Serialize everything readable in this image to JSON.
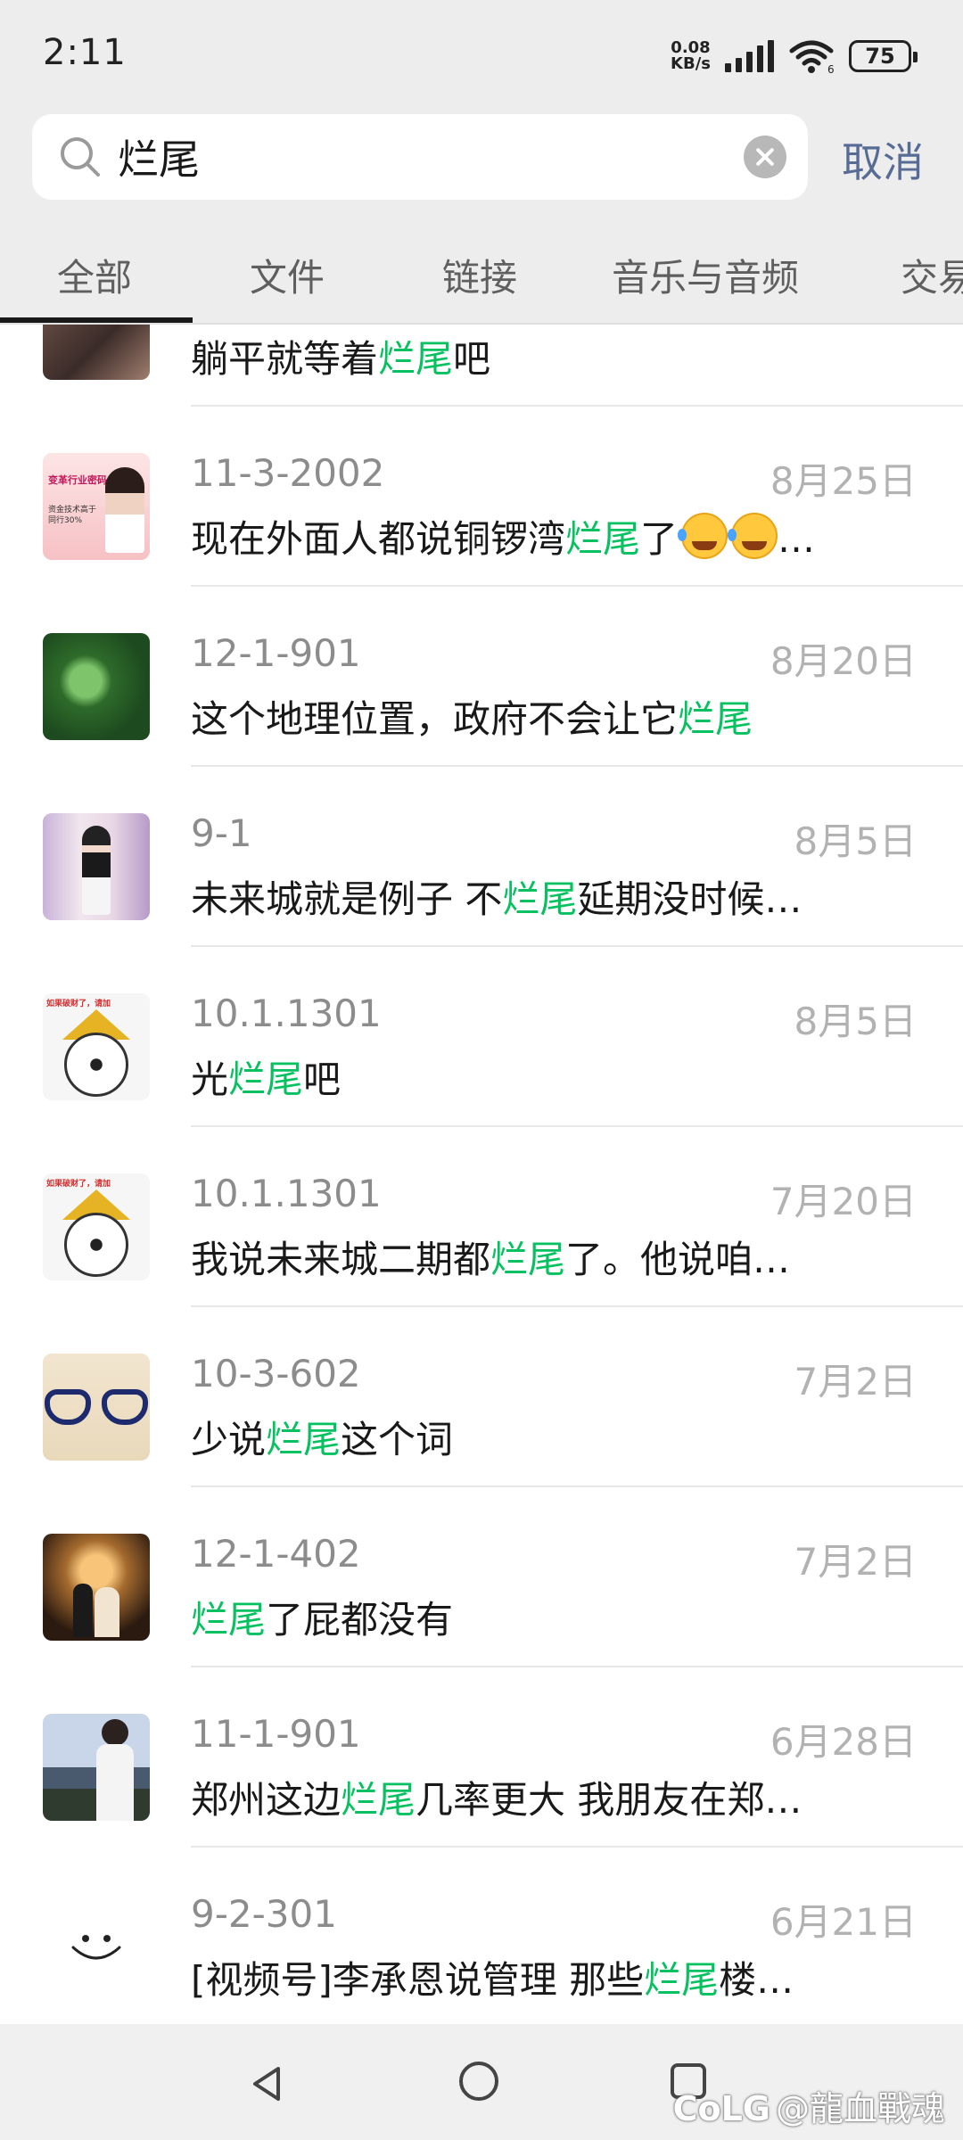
{
  "status_bar": {
    "time": "2:11",
    "net_speed_value": "0.08",
    "net_speed_unit": "KB/s",
    "battery": "75",
    "wifi_badge": "6"
  },
  "search": {
    "query": "烂尾",
    "cancel_label": "取消"
  },
  "tabs": [
    {
      "label": "全部",
      "active": true
    },
    {
      "label": "文件",
      "active": false
    },
    {
      "label": "链接",
      "active": false
    },
    {
      "label": "音乐与音频",
      "active": false
    },
    {
      "label": "交易",
      "active": false
    }
  ],
  "keyword": "烂尾",
  "results": [
    {
      "name": "",
      "date": "",
      "msg_before": "躺平就等着",
      "msg_after": "吧",
      "avatar": "photo-dark"
    },
    {
      "name": "11-3-2002",
      "date": "8月25日",
      "msg_before": "现在外面人都说铜锣湾",
      "msg_after": "了",
      "emoji_count": 2,
      "ellipsis": "…",
      "avatar": "ad-poster",
      "avatar_text_1": "变革行业密码",
      "avatar_text_2": "资金技术高于同行30%"
    },
    {
      "name": "12-1-901",
      "date": "8月20日",
      "msg_before": "这个地理位置，政府不会让它",
      "msg_after": "",
      "avatar": "green-lotus"
    },
    {
      "name": "9-1",
      "date": "8月5日",
      "msg_before": "未来城就是例子 不",
      "msg_after": "延期没时候…",
      "avatar": "girl-photo"
    },
    {
      "name": "10.1.1301",
      "date": "8月5日",
      "msg_before": "光",
      "msg_after": "吧",
      "avatar": "football-crown",
      "avatar_text_1": "如果破财了，请加"
    },
    {
      "name": "10.1.1301",
      "date": "7月20日",
      "msg_before": "我说未来城二期都",
      "msg_after": "了。他说咱…",
      "avatar": "football-crown",
      "avatar_text_1": "如果破财了，请加"
    },
    {
      "name": "10-3-602",
      "date": "7月2日",
      "msg_before": "少说",
      "msg_after": "这个词",
      "avatar": "glasses"
    },
    {
      "name": "12-1-402",
      "date": "7月2日",
      "msg_before": "",
      "msg_after": "了屁都没有",
      "avatar": "wedding"
    },
    {
      "name": "11-1-901",
      "date": "6月28日",
      "msg_before": "郑州这边",
      "msg_after": "几率更大 我朋友在郑…",
      "avatar": "man-sea"
    },
    {
      "name": "9-2-301",
      "date": "6月21日",
      "msg_before": "[视频号]李承恩说管理 那些",
      "msg_after": "楼…",
      "avatar": "smiley"
    }
  ],
  "watermark": "@龍血戰魂",
  "watermark_logo": "CoLG",
  "colors": {
    "highlight": "#07c160",
    "cancel": "#576b95",
    "background": "#ededed"
  }
}
